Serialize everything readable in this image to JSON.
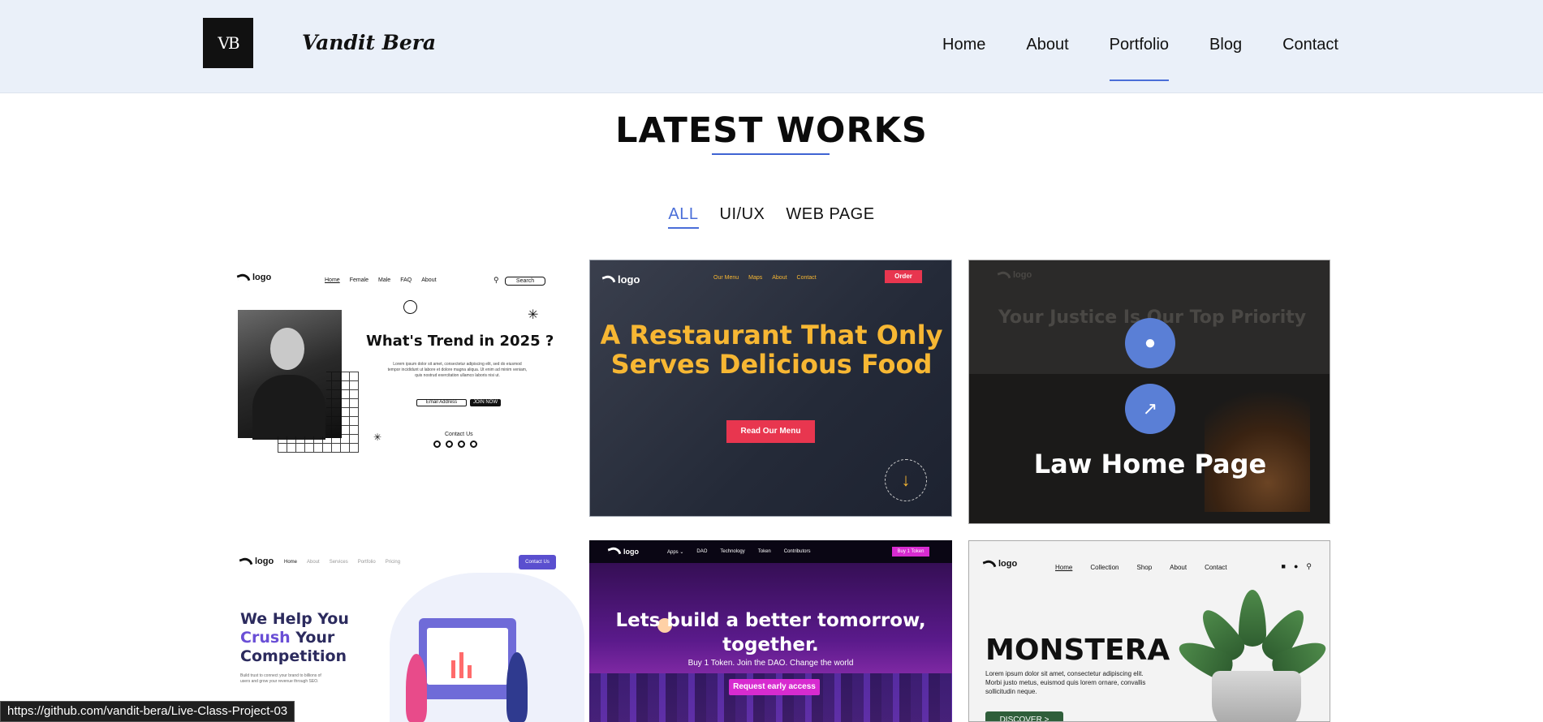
{
  "header": {
    "logo_text": "VB",
    "brand": "Vandit Bera",
    "nav": [
      {
        "label": "Home"
      },
      {
        "label": "About"
      },
      {
        "label": "Portfolio"
      },
      {
        "label": "Blog"
      },
      {
        "label": "Contact"
      }
    ],
    "active_nav": "Portfolio"
  },
  "section": {
    "title": "LATEST WORKS",
    "filters": [
      {
        "label": "ALL"
      },
      {
        "label": "UI/UX"
      },
      {
        "label": "WEB PAGE"
      }
    ],
    "active_filter": "ALL"
  },
  "cards": {
    "c1": {
      "logo": "logo",
      "nav": [
        "Home",
        "Female",
        "Male",
        "FAQ",
        "About"
      ],
      "search": "Search",
      "headline": "What's Trend in 2025 ?",
      "lorem": "Lorem ipsum dolor sit amet, consectetur adipiscing elit, sed do eiusmod tempor incididunt ut labore et dolore magna aliqua. Ut enim ad minim veniam, quis nostrud exercitation ullamco laboris nisi ut.",
      "email": "Email Address",
      "join": "JOIN NOW",
      "contact": "Contact Us"
    },
    "c2": {
      "logo": "logo",
      "nav": [
        "Our Menu",
        "Maps",
        "About",
        "Contact"
      ],
      "order": "Order",
      "headline": "A Restaurant That Only Serves Delicious Food",
      "button": "Read Our Menu",
      "scroll": "scroll"
    },
    "c3": {
      "logo": "logo",
      "faded_headline": "Your Justice Is Our Top Priority",
      "title": "Law Home Page",
      "github_icon": "github-icon",
      "link_icon": "external-link-icon"
    },
    "c4": {
      "logo": "logo",
      "nav": [
        "Home",
        "About",
        "Services",
        "Portfolio",
        "Pricing"
      ],
      "contact_button": "Contact Us",
      "headline_1": "We Help You",
      "headline_accent": "Crush",
      "headline_2": " Your",
      "headline_3": "Competition",
      "sub": "Build trust to connect your brand to billions of users and grow your revenue through SEO."
    },
    "c5": {
      "logo": "logo",
      "nav": [
        "Apps ⌄",
        "DAO",
        "Technology",
        "Token",
        "Contributors"
      ],
      "buy": "Buy 1 Token",
      "headline": "Lets build a better tomorrow, together.",
      "sub": "Buy 1 Token. Join the DAO. Change the world",
      "button": "Request early access"
    },
    "c6": {
      "logo": "logo",
      "nav": [
        "Home",
        "Collection",
        "Shop",
        "About",
        "Contact"
      ],
      "headline": "MONSTERA",
      "sub": "Lorem ipsum dolor sit amet, consectetur adipiscing elit. Morbi justo metus, euismod quis lorem ornare, convallis sollicitudin neque.",
      "button": "DISCOVER >"
    }
  },
  "status_bar": {
    "url": "https://github.com/vandit-bera/Live-Class-Project-03"
  },
  "colors": {
    "header_bg": "#eaf0f9",
    "accent": "#4a6ed8",
    "overlay_button": "#5a7fd6"
  }
}
